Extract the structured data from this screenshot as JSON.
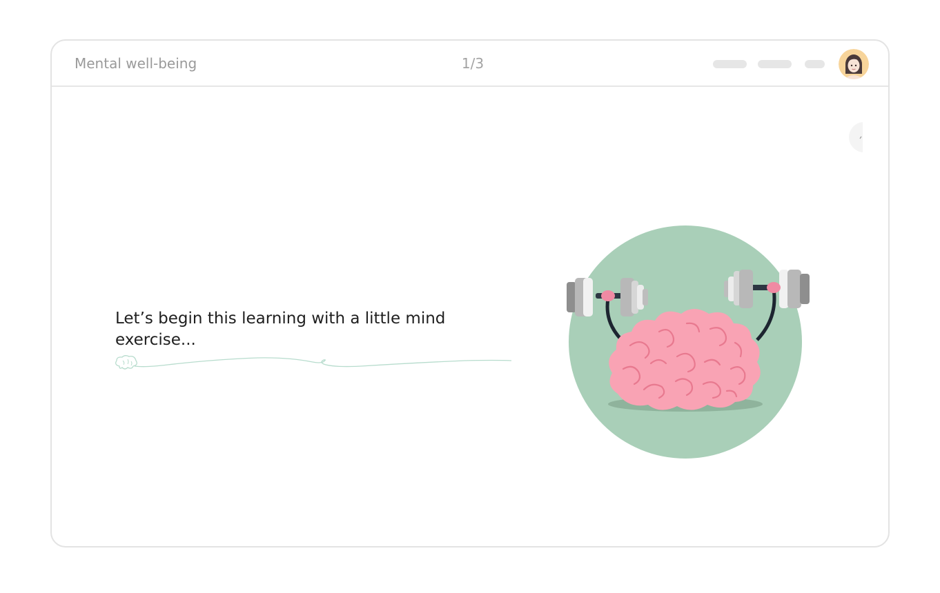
{
  "header": {
    "course_title": "Mental well-being",
    "progress": "1/3",
    "nav_placeholders": [
      "placeholder-1",
      "placeholder-2",
      "placeholder-3"
    ],
    "avatar_icon": "user-avatar-woman"
  },
  "main": {
    "intro_text": "Let’s begin this learning with a little mind exercise...",
    "illustration_icon": "brain-lifting-dumbbells",
    "squiggle_icon": "brain-doodle-line",
    "side_tab_icon": "collapse-panel-tab"
  },
  "colors": {
    "border": "#e3e3e3",
    "muted_text": "#9a9a9a",
    "body_text": "#1f1f1f",
    "circle_green": "#a9cfb8",
    "brain_pink": "#f9a3b4",
    "line_green": "#b7dccd"
  }
}
